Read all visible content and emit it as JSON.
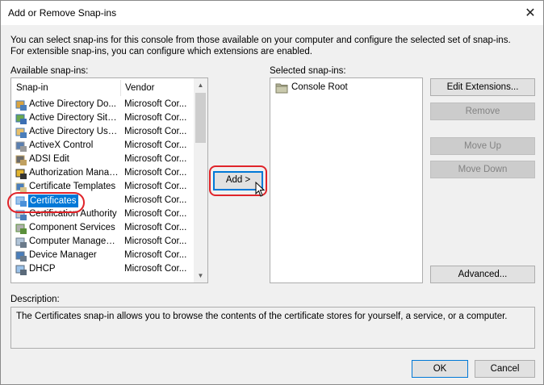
{
  "window": {
    "title": "Add or Remove Snap-ins"
  },
  "intro": "You can select snap-ins for this console from those available on your computer and configure the selected set of snap-ins. For extensible snap-ins, you can configure which extensions are enabled.",
  "available": {
    "label": "Available snap-ins:",
    "columns": {
      "snapin": "Snap-in",
      "vendor": "Vendor"
    },
    "items": [
      {
        "name": "Active Directory Do...",
        "vendor": "Microsoft Cor...",
        "icon": "ad-domains-icon"
      },
      {
        "name": "Active Directory Site...",
        "vendor": "Microsoft Cor...",
        "icon": "ad-sites-icon"
      },
      {
        "name": "Active Directory Use...",
        "vendor": "Microsoft Cor...",
        "icon": "ad-users-icon"
      },
      {
        "name": "ActiveX Control",
        "vendor": "Microsoft Cor...",
        "icon": "activex-icon"
      },
      {
        "name": "ADSI Edit",
        "vendor": "Microsoft Cor...",
        "icon": "adsi-edit-icon"
      },
      {
        "name": "Authorization Manager",
        "vendor": "Microsoft Cor...",
        "icon": "authorization-icon"
      },
      {
        "name": "Certificate Templates",
        "vendor": "Microsoft Cor...",
        "icon": "cert-templates-icon"
      },
      {
        "name": "Certificates",
        "vendor": "Microsoft Cor...",
        "icon": "certificates-icon"
      },
      {
        "name": "Certification Authority",
        "vendor": "Microsoft Cor...",
        "icon": "cert-authority-icon"
      },
      {
        "name": "Component Services",
        "vendor": "Microsoft Cor...",
        "icon": "component-services-icon"
      },
      {
        "name": "Computer Managem...",
        "vendor": "Microsoft Cor...",
        "icon": "computer-management-icon"
      },
      {
        "name": "Device Manager",
        "vendor": "Microsoft Cor...",
        "icon": "device-manager-icon"
      },
      {
        "name": "DHCP",
        "vendor": "Microsoft Cor...",
        "icon": "dhcp-icon"
      }
    ]
  },
  "add_button": "Add >",
  "selected": {
    "label": "Selected snap-ins:",
    "items": [
      {
        "name": "Console Root",
        "icon": "folder-icon"
      }
    ]
  },
  "buttons": {
    "edit_extensions": "Edit Extensions...",
    "remove": "Remove",
    "move_up": "Move Up",
    "move_down": "Move Down",
    "advanced": "Advanced...",
    "ok": "OK",
    "cancel": "Cancel"
  },
  "description": {
    "label": "Description:",
    "text": "The Certificates snap-in allows you to browse the contents of the certificate stores for yourself, a service, or a computer."
  },
  "colors": {
    "selection": "#0078d7",
    "annotation": "#e0242a"
  }
}
